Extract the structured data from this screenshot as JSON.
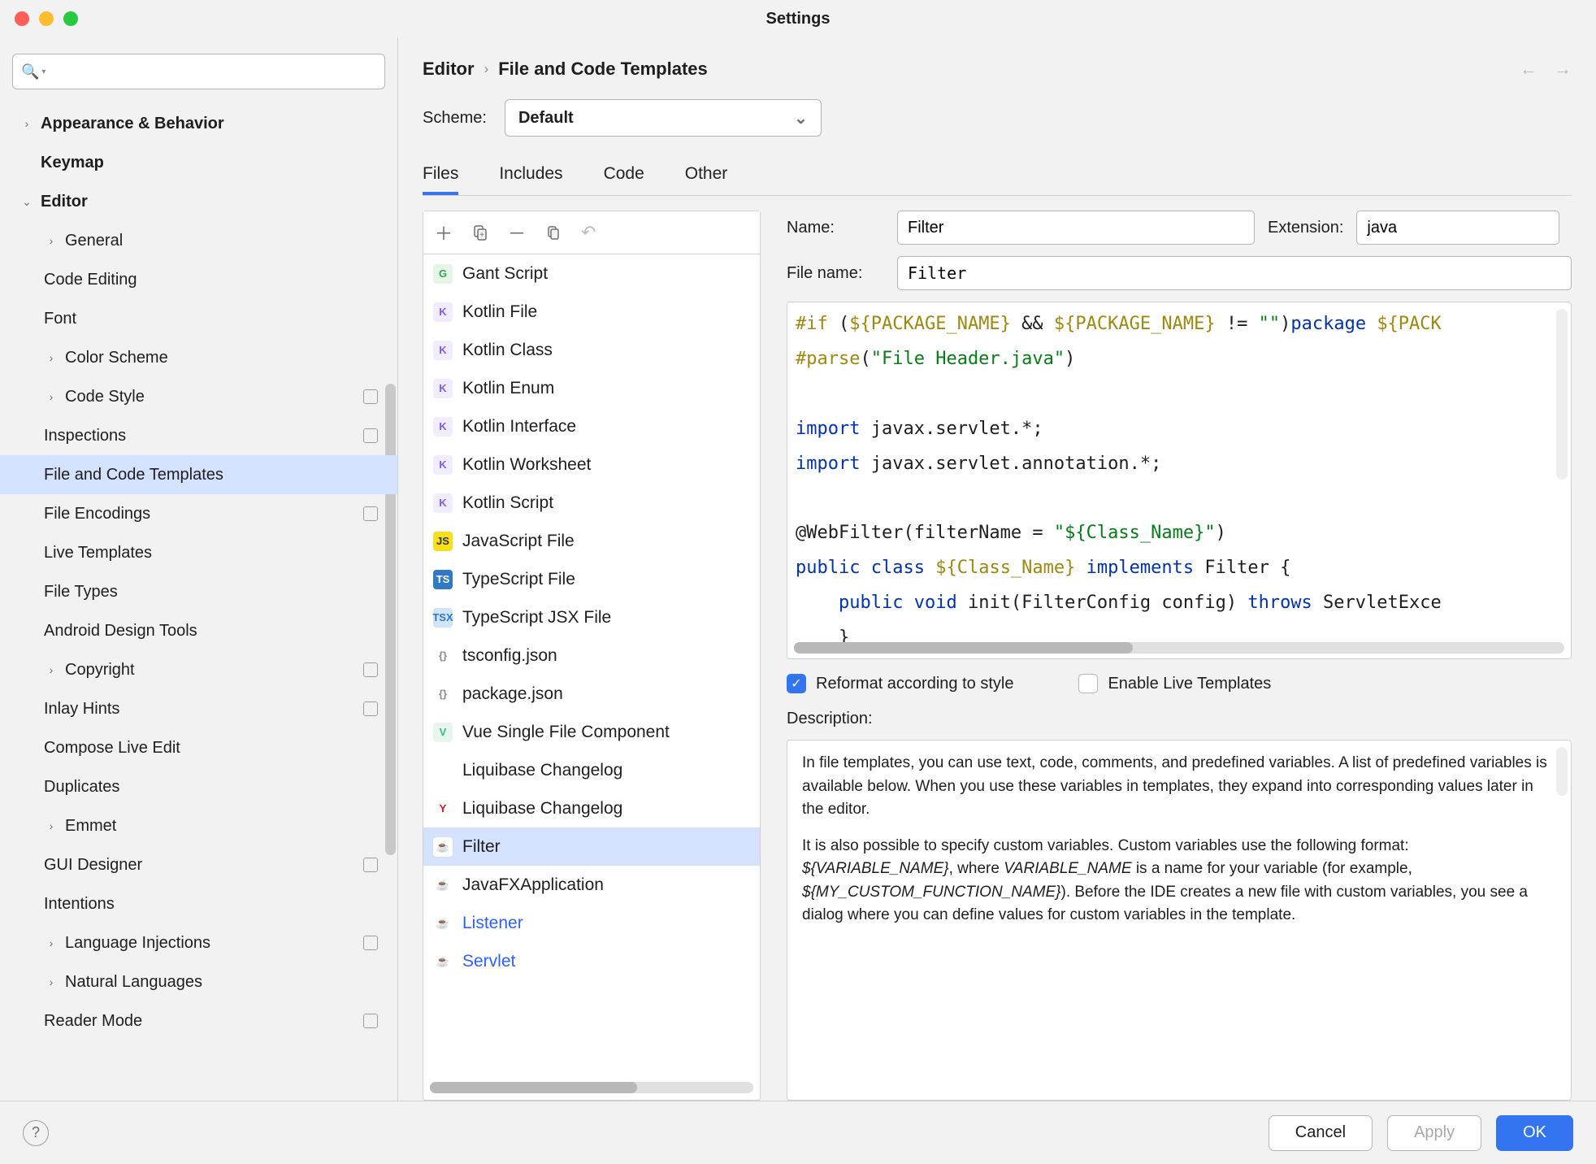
{
  "title": "Settings",
  "breadcrumb": {
    "parent": "Editor",
    "current": "File and Code Templates"
  },
  "scheme": {
    "label": "Scheme:",
    "value": "Default"
  },
  "tabs": [
    "Files",
    "Includes",
    "Code",
    "Other"
  ],
  "active_tab": 0,
  "sidebar": {
    "items": [
      {
        "label": "Appearance & Behavior",
        "bold": true,
        "arrow": "right",
        "lvl": 0
      },
      {
        "label": "Keymap",
        "bold": true,
        "lvl": 0
      },
      {
        "label": "Editor",
        "bold": true,
        "arrow": "down",
        "lvl": 0
      },
      {
        "label": "General",
        "arrow": "right",
        "lvl": 1
      },
      {
        "label": "Code Editing",
        "lvl": 1
      },
      {
        "label": "Font",
        "lvl": 1
      },
      {
        "label": "Color Scheme",
        "arrow": "right",
        "lvl": 1
      },
      {
        "label": "Code Style",
        "arrow": "right",
        "lvl": 1,
        "badge": true
      },
      {
        "label": "Inspections",
        "lvl": 1,
        "badge": true
      },
      {
        "label": "File and Code Templates",
        "lvl": 1,
        "selected": true
      },
      {
        "label": "File Encodings",
        "lvl": 1,
        "badge": true
      },
      {
        "label": "Live Templates",
        "lvl": 1
      },
      {
        "label": "File Types",
        "lvl": 1
      },
      {
        "label": "Android Design Tools",
        "lvl": 1
      },
      {
        "label": "Copyright",
        "arrow": "right",
        "lvl": 1,
        "badge": true
      },
      {
        "label": "Inlay Hints",
        "lvl": 1,
        "badge": true
      },
      {
        "label": "Compose Live Edit",
        "lvl": 1
      },
      {
        "label": "Duplicates",
        "lvl": 1
      },
      {
        "label": "Emmet",
        "arrow": "right",
        "lvl": 1
      },
      {
        "label": "GUI Designer",
        "lvl": 1,
        "badge": true
      },
      {
        "label": "Intentions",
        "lvl": 1
      },
      {
        "label": "Language Injections",
        "arrow": "right",
        "lvl": 1,
        "badge": true
      },
      {
        "label": "Natural Languages",
        "arrow": "right",
        "lvl": 1
      },
      {
        "label": "Reader Mode",
        "lvl": 1,
        "badge": true
      }
    ]
  },
  "templates": [
    {
      "label": "Gant Script",
      "icon": "G",
      "iconbg": "#e7f5e8",
      "iconfg": "#2fa84f"
    },
    {
      "label": "Kotlin File",
      "icon": "K",
      "iconbg": "#f1ecff",
      "iconfg": "#7e5bef"
    },
    {
      "label": "Kotlin Class",
      "icon": "K",
      "iconbg": "#f1ecff",
      "iconfg": "#7e5bef"
    },
    {
      "label": "Kotlin Enum",
      "icon": "K",
      "iconbg": "#f1ecff",
      "iconfg": "#7e5bef"
    },
    {
      "label": "Kotlin Interface",
      "icon": "K",
      "iconbg": "#f1ecff",
      "iconfg": "#7e5bef"
    },
    {
      "label": "Kotlin Worksheet",
      "icon": "K",
      "iconbg": "#f1ecff",
      "iconfg": "#7e5bef"
    },
    {
      "label": "Kotlin Script",
      "icon": "K",
      "iconbg": "#f1ecff",
      "iconfg": "#7e5bef"
    },
    {
      "label": "JavaScript File",
      "icon": "JS",
      "iconbg": "#f7df1e",
      "iconfg": "#333"
    },
    {
      "label": "TypeScript File",
      "icon": "TS",
      "iconbg": "#3178c6",
      "iconfg": "#fff"
    },
    {
      "label": "TypeScript JSX File",
      "icon": "TSX",
      "iconbg": "#cfe4f7",
      "iconfg": "#3178c6"
    },
    {
      "label": "tsconfig.json",
      "icon": "{}",
      "iconbg": "#fff",
      "iconfg": "#888"
    },
    {
      "label": "package.json",
      "icon": "{}",
      "iconbg": "#fff",
      "iconfg": "#888"
    },
    {
      "label": "Vue Single File Component",
      "icon": "V",
      "iconbg": "#e7f5ef",
      "iconfg": "#41b883"
    },
    {
      "label": "Liquibase Changelog",
      "icon": "</>",
      "iconbg": "#fff",
      "iconfg": "#e8762d"
    },
    {
      "label": "Liquibase Changelog",
      "icon": "Y",
      "iconbg": "#fff",
      "iconfg": "#cb171e"
    },
    {
      "label": "Filter",
      "icon": "☕",
      "iconbg": "#fff",
      "iconfg": "#e8762d",
      "selected": true
    },
    {
      "label": "JavaFXApplication",
      "icon": "☕",
      "iconbg": "#fff",
      "iconfg": "#e8762d"
    },
    {
      "label": "Listener",
      "icon": "☕",
      "iconbg": "#fff",
      "iconfg": "#e8762d",
      "modified": true
    },
    {
      "label": "Servlet",
      "icon": "☕",
      "iconbg": "#fff",
      "iconfg": "#e8762d",
      "modified": true
    }
  ],
  "form": {
    "name_label": "Name:",
    "name_value": "Filter",
    "ext_label": "Extension:",
    "ext_value": "java",
    "fname_label": "File name:",
    "fname_value": "Filter"
  },
  "checks": {
    "reformat_label": "Reformat according to style",
    "reformat_checked": true,
    "live_label": "Enable Live Templates",
    "live_checked": false
  },
  "desc_label": "Description:",
  "desc": {
    "p1": "In file templates, you can use text, code, comments, and predefined variables. A list of predefined variables is available below. When you use these variables in templates, they expand into corresponding values later in the editor.",
    "p2a": "It is also possible to specify custom variables. Custom variables use the following format: ",
    "p2v1": "${VARIABLE_NAME}",
    "p2b": ", where ",
    "p2v2": "VARIABLE_NAME",
    "p2c": " is a name for your variable (for example, ",
    "p2v3": "${MY_CUSTOM_FUNCTION_NAME}",
    "p2d": "). Before the IDE creates a new file with custom variables, you see a dialog where you can define values for custom variables in the template."
  },
  "buttons": {
    "cancel": "Cancel",
    "apply": "Apply",
    "ok": "OK"
  }
}
